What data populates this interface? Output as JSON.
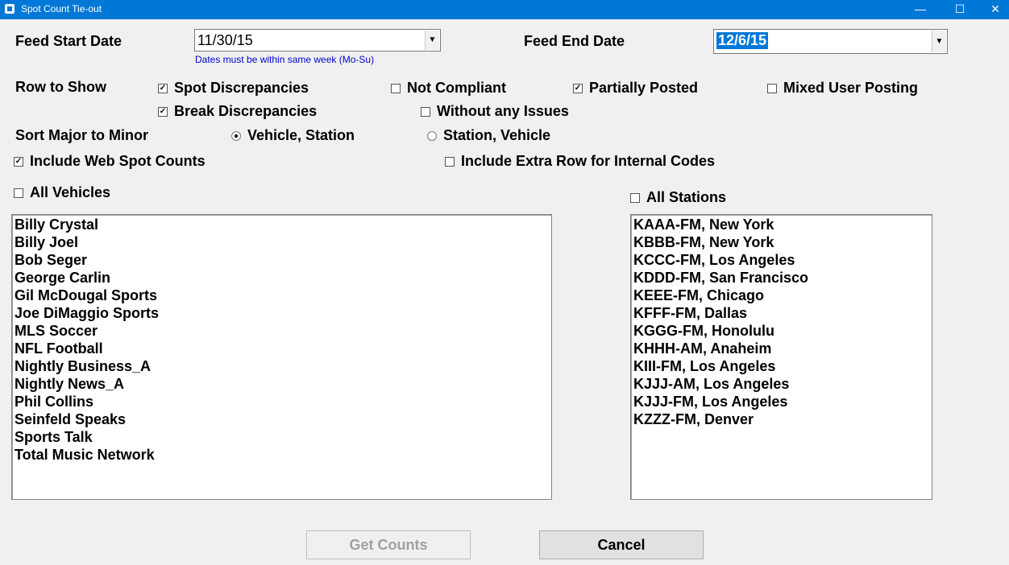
{
  "window": {
    "title": "Spot Count Tie-out",
    "minimize": "—",
    "maximize": "☐",
    "close": "✕"
  },
  "feed_start": {
    "label": "Feed Start Date",
    "value": "11/30/15",
    "hint": "Dates must be within same week (Mo-Su)"
  },
  "feed_end": {
    "label": "Feed End Date",
    "value": "12/6/15"
  },
  "rows": {
    "label": "Row to Show",
    "spot_discrepancies": {
      "label": "Spot Discrepancies",
      "checked": true
    },
    "not_compliant": {
      "label": "Not Compliant",
      "checked": false
    },
    "partially_posted": {
      "label": "Partially Posted",
      "checked": true
    },
    "mixed_user_posting": {
      "label": "Mixed User Posting",
      "checked": false
    },
    "break_discrepancies": {
      "label": "Break Discrepancies",
      "checked": true
    },
    "without_issues": {
      "label": "Without any Issues",
      "checked": false
    }
  },
  "sort": {
    "label": "Sort Major to Minor",
    "vehicle_station": {
      "label": "Vehicle, Station",
      "selected": true
    },
    "station_vehicle": {
      "label": "Station, Vehicle",
      "selected": false
    }
  },
  "include_web": {
    "label": "Include Web Spot Counts",
    "checked": true
  },
  "include_extra": {
    "label": "Include Extra Row for Internal Codes",
    "checked": false
  },
  "all_vehicles": {
    "label": "All Vehicles",
    "checked": false
  },
  "all_stations": {
    "label": "All Stations",
    "checked": false
  },
  "vehicles": [
    "Billy Crystal",
    "Billy Joel",
    "Bob Seger",
    "George Carlin",
    "Gil McDougal Sports",
    "Joe DiMaggio Sports",
    "MLS Soccer",
    "NFL Football",
    "Nightly Business_A",
    "Nightly News_A",
    "Phil Collins",
    "Seinfeld Speaks",
    "Sports Talk",
    "Total Music Network"
  ],
  "stations": [
    "KAAA-FM, New York",
    "KBBB-FM, New York",
    "KCCC-FM, Los Angeles",
    "KDDD-FM, San Francisco",
    "KEEE-FM, Chicago",
    "KFFF-FM, Dallas",
    "KGGG-FM, Honolulu",
    "KHHH-AM, Anaheim",
    "KIII-FM, Los Angeles",
    "KJJJ-AM, Los Angeles",
    "KJJJ-FM, Los Angeles",
    "KZZZ-FM, Denver"
  ],
  "buttons": {
    "get_counts": "Get Counts",
    "cancel": "Cancel"
  }
}
